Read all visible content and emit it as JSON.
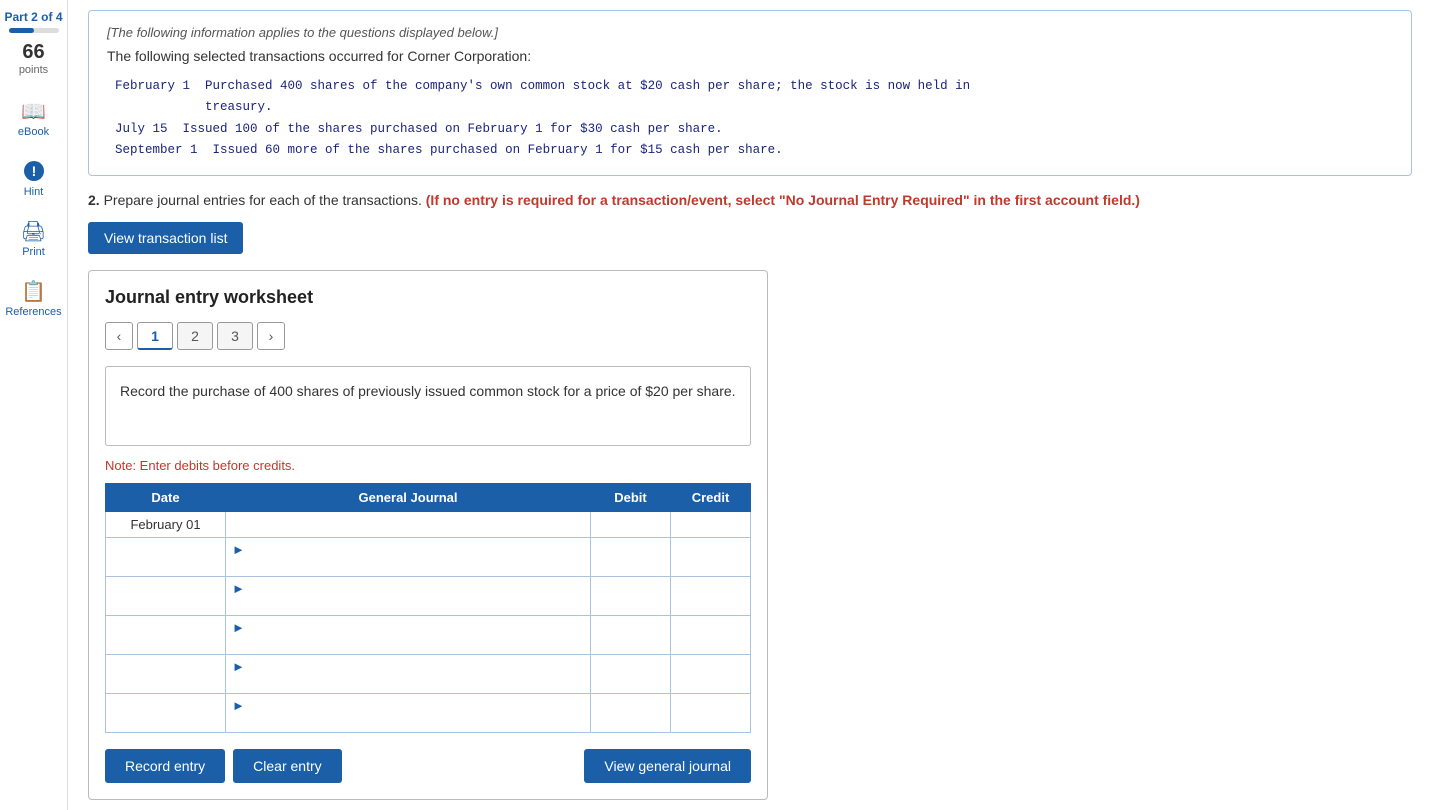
{
  "sidebar": {
    "part_label": "Part 2 of 4",
    "points": "66",
    "points_label": "points",
    "items": [
      {
        "id": "ebook",
        "icon": "📖",
        "label": "eBook"
      },
      {
        "id": "hint",
        "icon": "💡",
        "label": "Hint"
      },
      {
        "id": "print",
        "icon": "🖨",
        "label": "Print"
      },
      {
        "id": "references",
        "icon": "📋",
        "label": "References"
      }
    ]
  },
  "info_box": {
    "italic_note": "[The following information applies to the questions displayed below.]",
    "intro_text": "The following selected transactions occurred for Corner Corporation:",
    "transactions": [
      "February 1  Purchased 400 shares of the company's own common stock at $20 cash per share; the stock is now held in",
      "            treasury.",
      "July 15  Issued 100 of the shares purchased on February 1 for $30 cash per share.",
      "September 1  Issued 60 more of the shares purchased on February 1 for $15 cash per share."
    ]
  },
  "question": {
    "number": "2.",
    "text": "Prepare journal entries for each of the transactions.",
    "bold_red": "(If no entry is required for a transaction/event, select \"No Journal Entry Required\" in the first account field.)"
  },
  "view_transaction_btn": "View transaction list",
  "worksheet": {
    "title": "Journal entry worksheet",
    "tabs": [
      {
        "label": "1",
        "active": true
      },
      {
        "label": "2",
        "active": false
      },
      {
        "label": "3",
        "active": false
      }
    ],
    "description": "Record the purchase of 400 shares of previously issued common stock for a price of $20 per share.",
    "note": "Note: Enter debits before credits.",
    "table": {
      "headers": [
        "Date",
        "General Journal",
        "Debit",
        "Credit"
      ],
      "rows": [
        {
          "date": "February 01",
          "journal": "",
          "debit": "",
          "credit": ""
        },
        {
          "date": "",
          "journal": "",
          "debit": "",
          "credit": ""
        },
        {
          "date": "",
          "journal": "",
          "debit": "",
          "credit": ""
        },
        {
          "date": "",
          "journal": "",
          "debit": "",
          "credit": ""
        },
        {
          "date": "",
          "journal": "",
          "debit": "",
          "credit": ""
        },
        {
          "date": "",
          "journal": "",
          "debit": "",
          "credit": ""
        }
      ]
    },
    "buttons": {
      "record": "Record entry",
      "clear": "Clear entry",
      "view_general": "View general journal"
    }
  }
}
